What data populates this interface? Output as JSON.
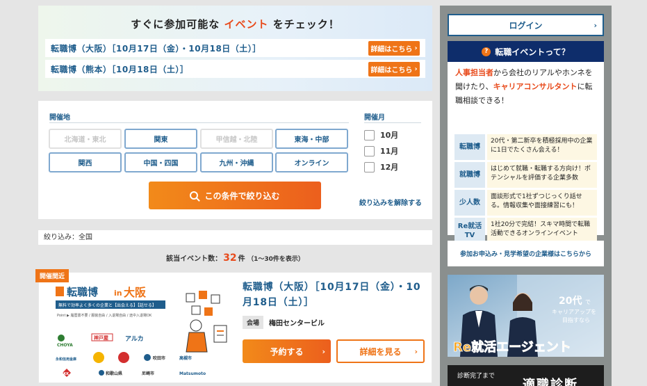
{
  "upcoming": {
    "title_pre": "すぐに参加可能な",
    "title_accent": "イベント",
    "title_post": "をチェック！",
    "rows": [
      {
        "label": "転職博（大阪）［10月17日（金）・10月18日（土）］",
        "button": "詳細はこちら"
      },
      {
        "label": "転職博（熊本）［10月18日（土）］",
        "button": "詳細はこちら"
      }
    ]
  },
  "filter": {
    "area_heading": "開催地",
    "month_heading": "開催月",
    "areas": [
      {
        "label": "北海道・東北",
        "enabled": false
      },
      {
        "label": "関東",
        "enabled": true
      },
      {
        "label": "甲信越・北陸",
        "enabled": false
      },
      {
        "label": "東海・中部",
        "enabled": true
      },
      {
        "label": "関西",
        "enabled": true
      },
      {
        "label": "中国・四国",
        "enabled": true
      },
      {
        "label": "九州・沖縄",
        "enabled": true
      },
      {
        "label": "オンライン",
        "enabled": true
      }
    ],
    "months": [
      "10月",
      "11月",
      "12月"
    ],
    "search_button": "この条件で絞り込む",
    "reset_link": "絞り込みを解除する"
  },
  "narrow": "絞り込み：全国",
  "count": {
    "pre": "該当イベント数：",
    "num": "32",
    "unit": "件",
    "range": "（1〜30件を表示）"
  },
  "event": {
    "badge": "開催間近",
    "title": "転職博（大阪）［10月17日（金）・10月18日（土）］",
    "venue_tag": "会場",
    "venue": "梅田センタービル",
    "reserve_button": "予約する",
    "detail_button": "詳細を見る",
    "thumb": {
      "logo": "転職博",
      "in": "in",
      "city": "大阪",
      "tagline": "無料で効率よく多くの企業と【出会える】【話せる】",
      "points": "Point ▶ 履歴書不要 / 服装自由 / 入退場自由 / 途中入退場OK",
      "logos": [
        "CHOYA",
        "神戸屋",
        "アルカ",
        "永和信用金庫",
        "",
        "",
        "吹田市",
        "高槻市",
        "FKK",
        "和歌山県",
        "尼崎市",
        "Matsumoto"
      ]
    }
  },
  "sidebar": {
    "login": "ログイン",
    "what_title": "転職イベントって？",
    "desc": {
      "hl1": "人事担当者",
      "t1": "から会社のリアルやホンネを聞けたり、",
      "hl2": "キャリアコンサルタント",
      "t2": "に転職相談できる！"
    },
    "items": [
      {
        "k": "転職博",
        "v": "20代・第二新卒を積極採用中の企業に1日でたくさん会える！"
      },
      {
        "k": "就職博",
        "v": "はじめて就職・転職する方向け！ポテンシャルを評価する企業多数"
      },
      {
        "k": "少人数",
        "v": "面談形式で1社ずつじっくり話せる。情報収集や面接練習にも！"
      },
      {
        "k": "Re就活TV",
        "v": "1社20分で完結！スキマ時間で転職活動できるオンラインイベント"
      }
    ],
    "apply": "参加お申込み・見学希望の企業様はこちらから",
    "banner": {
      "age": "20代",
      "age_suffix": "で",
      "career": "キャリアアップを",
      "aim": "目指すなら",
      "brand": "Re就活エージェント"
    },
    "banner2": {
      "small": "診断完了まで",
      "big": "適職診断"
    }
  },
  "colors": {
    "navy": "#0e2d6b",
    "link_blue": "#1f5d8c",
    "orange": "#ef7417",
    "red_accent": "#e84a1b"
  }
}
